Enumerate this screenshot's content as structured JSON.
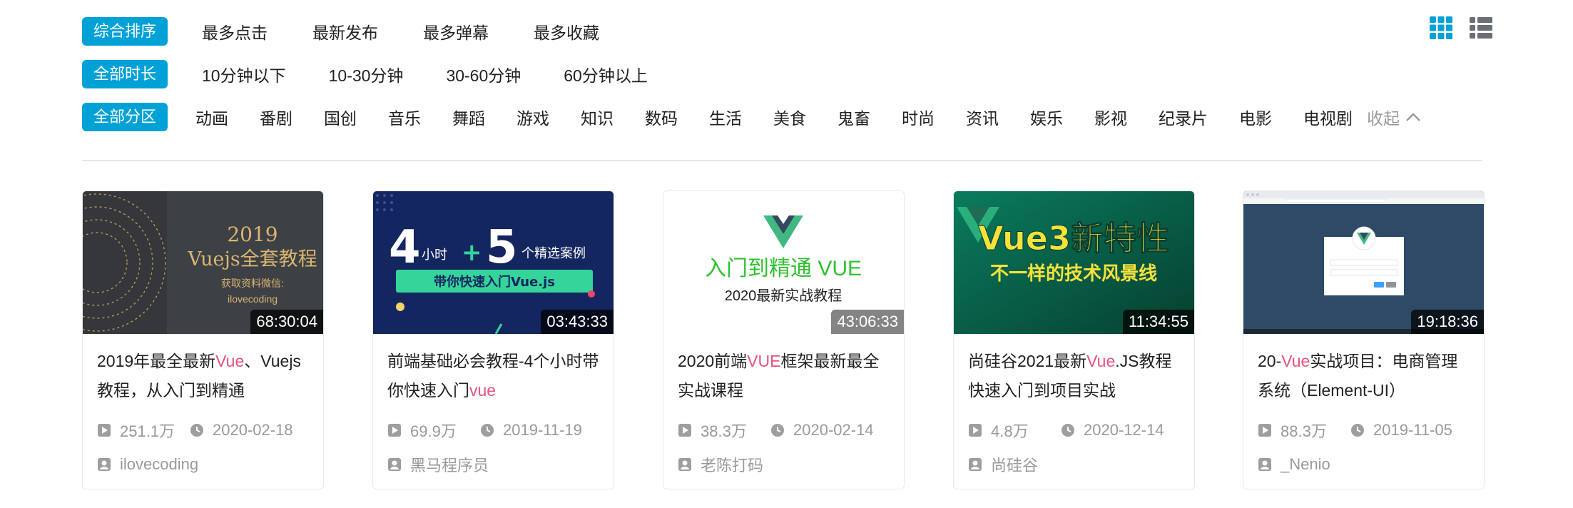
{
  "sort": {
    "active": "综合排序",
    "options": [
      "最多点击",
      "最新发布",
      "最多弹幕",
      "最多收藏"
    ]
  },
  "duration": {
    "active": "全部时长",
    "options": [
      "10分钟以下",
      "10-30分钟",
      "30-60分钟",
      "60分钟以上"
    ]
  },
  "zone": {
    "active": "全部分区",
    "options": [
      "动画",
      "番剧",
      "国创",
      "音乐",
      "舞蹈",
      "游戏",
      "知识",
      "数码",
      "生活",
      "美食",
      "鬼畜",
      "时尚",
      "资讯",
      "娱乐",
      "影视",
      "纪录片",
      "电影",
      "电视剧"
    ],
    "collapse_label": "收起"
  },
  "colors": {
    "accent": "#00a1d6",
    "highlight": "#e5537c",
    "muted": "#999999"
  },
  "cards": [
    {
      "duration": "68:30:04",
      "title_parts": [
        "2019年最全最新",
        "Vue",
        "、Vuejs教程，从入门到精通"
      ],
      "plays": "251.1万",
      "date": "2020-02-18",
      "author": "ilovecoding",
      "thumb_text": [
        "2019",
        "Vuejs全套教程",
        "获取资料微信:",
        "ilovecoding"
      ]
    },
    {
      "duration": "03:43:33",
      "title_parts": [
        "前端基础必会教程-4个小时带你快速入门",
        "vue",
        ""
      ],
      "plays": "69.9万",
      "date": "2019-11-19",
      "author": "黑马程序员",
      "thumb_text": [
        "4",
        "小时",
        "5",
        "个精选案例",
        "带你快速入门Vue.js"
      ]
    },
    {
      "duration": "43:06:33",
      "title_parts": [
        "2020前端",
        "VUE",
        "框架最新最全实战课程"
      ],
      "plays": "38.3万",
      "date": "2020-02-14",
      "author": "老陈打码",
      "thumb_text": [
        "入门到精通 VUE",
        "2020最新实战教程"
      ]
    },
    {
      "duration": "11:34:55",
      "title_parts": [
        "尚硅谷2021最新",
        "Vue",
        ".JS教程快速入门到项目实战"
      ],
      "plays": "4.8万",
      "date": "2020-12-14",
      "author": "尚硅谷",
      "thumb_text": [
        "Vue3新特性",
        "不一样的技术风景线"
      ]
    },
    {
      "duration": "19:18:36",
      "title_parts": [
        "20-",
        "Vue",
        "实战项目：电商管理系统（Element-UI）"
      ],
      "plays": "88.3万",
      "date": "2019-11-05",
      "author": "_Nenio",
      "thumb_text": []
    }
  ],
  "icons": {
    "play": "play-icon",
    "clock": "clock-icon",
    "user": "user-icon",
    "grid_view": "grid-view-icon",
    "list_view": "list-view-icon",
    "collapse": "chevron-up-icon"
  }
}
